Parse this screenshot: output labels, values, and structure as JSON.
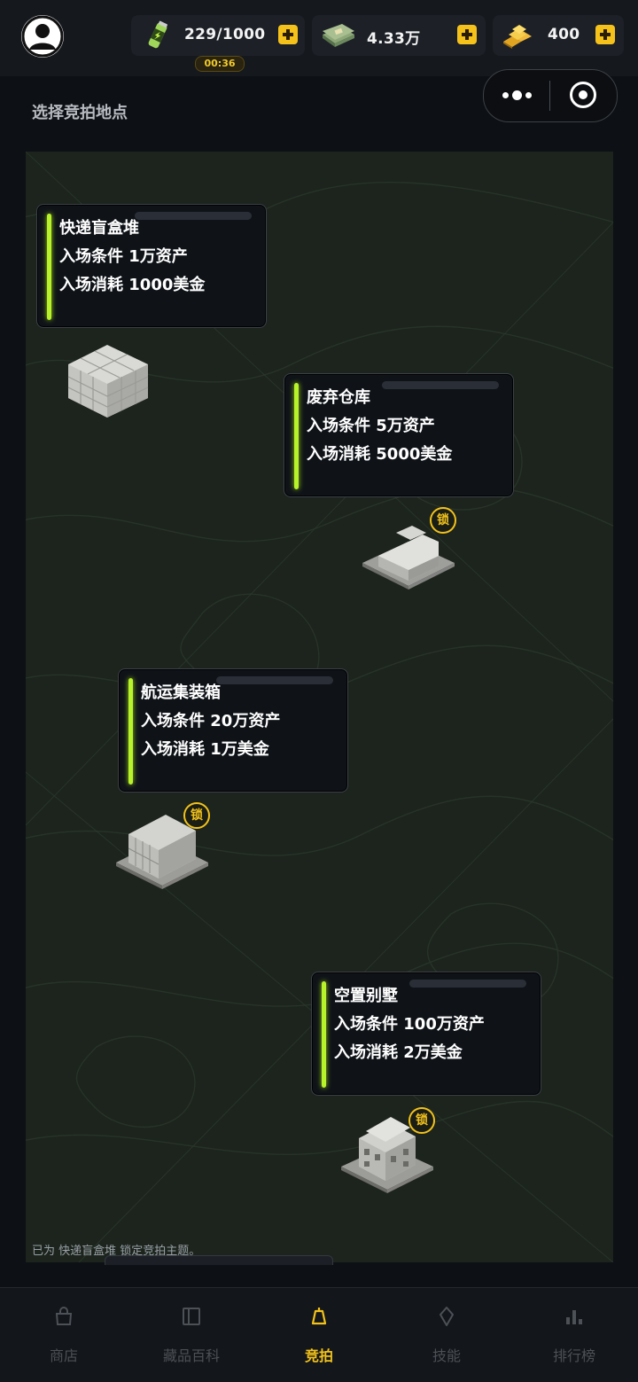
{
  "header": {
    "energy": {
      "value": "229/1000",
      "timer": "00:36",
      "icon": "energy-drink-icon"
    },
    "cash": {
      "value": "4.33万",
      "icon": "cash-stack-icon"
    },
    "gold": {
      "value": "400",
      "icon": "gold-bars-icon"
    }
  },
  "page_title": "选择竞拍地点",
  "locations": [
    {
      "name": "快递盲盒堆",
      "requirement": "入场条件 1万资产",
      "cost": "入场消耗 1000美金",
      "locked": false,
      "icon": "parcel-pile-icon"
    },
    {
      "name": "废弃仓库",
      "requirement": "入场条件 5万资产",
      "cost": "入场消耗 5000美金",
      "locked": true,
      "icon": "warehouse-icon"
    },
    {
      "name": "航运集装箱",
      "requirement": "入场条件 20万资产",
      "cost": "入场消耗 1万美金",
      "locked": true,
      "icon": "container-icon"
    },
    {
      "name": "空置别墅",
      "requirement": "入场条件 100万资产",
      "cost": "入场消耗 2万美金",
      "locked": true,
      "icon": "villa-icon"
    }
  ],
  "lock_label": "锁",
  "status_text": "已为 快递盲盒堆 锁定竞拍主题。",
  "nav": [
    {
      "label": "商店",
      "icon": "shop-icon",
      "active": false
    },
    {
      "label": "藏品百科",
      "icon": "book-icon",
      "active": false
    },
    {
      "label": "竞拍",
      "icon": "auction-icon",
      "active": true
    },
    {
      "label": "技能",
      "icon": "gem-icon",
      "active": false
    },
    {
      "label": "排行榜",
      "icon": "bar-chart-icon",
      "active": false
    }
  ]
}
